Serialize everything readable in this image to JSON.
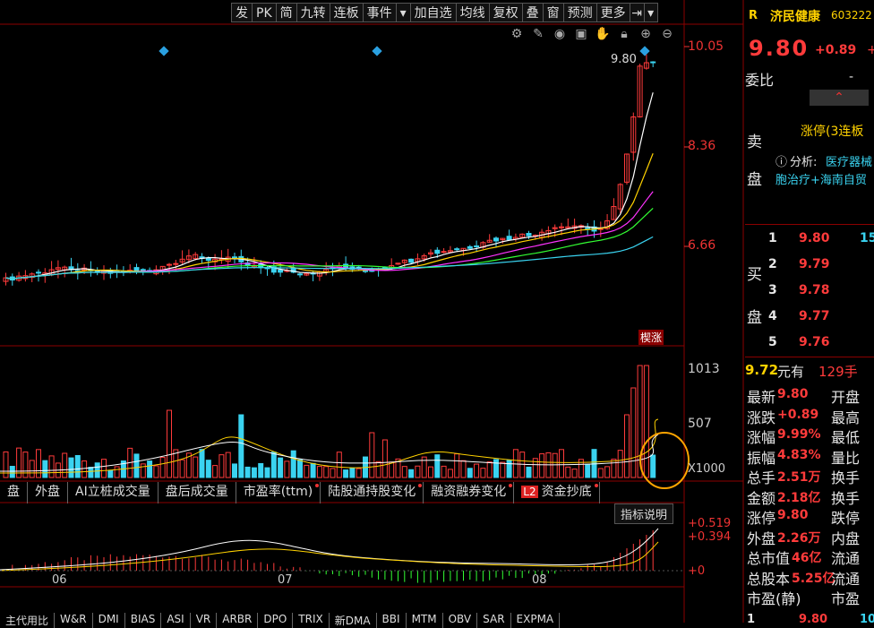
{
  "toolbar": {
    "items": [
      "发",
      "PK",
      "简",
      "九转",
      "连板",
      "事件",
      "加自选",
      "均线",
      "复权",
      "叠",
      "窗",
      "预测",
      "更多"
    ]
  },
  "chart": {
    "price_labels": [
      "10.05",
      "8.36",
      "6.66"
    ],
    "last_price_marker": "9.80",
    "limit_up_tag": "楔涨",
    "volume_labels": [
      "1013",
      "507",
      "X1000"
    ],
    "indicator_labels": [
      "+0.519",
      "+0.394",
      "+0"
    ],
    "indicator_help": "指标说明",
    "month_labels": [
      "06",
      "07",
      "08"
    ]
  },
  "indicator_tabs": [
    "盘",
    "外盘",
    "AI立桩成交量",
    "盘后成交量",
    "市盈率(ttm)",
    "陆股通持股变化",
    "融资融券变化",
    "资金抄底"
  ],
  "l2_badge": "L2",
  "bottom_tabs": [
    "主代用比",
    "W&R",
    "DMI",
    "BIAS",
    "ASI",
    "VR",
    "ARBR",
    "DPO",
    "TRIX",
    "新DMA",
    "BBI",
    "MTM",
    "OBV",
    "SAR",
    "EXPMA"
  ],
  "stock": {
    "tag": "R",
    "name": "济民健康",
    "code": "603222",
    "price": "9.80",
    "change": "+0.89",
    "change_tail": "+",
    "weibi_label": "委比",
    "weibi_value": "-",
    "sell_label_1": "卖",
    "sell_label_2": "盘",
    "limit_status": "涨停(3连板",
    "analysis_label": "分析:",
    "analysis_value": "医疗器械",
    "analysis_line2": "胞治疗+海南自贸",
    "buy_label_1": "买",
    "buy_label_2": "盘",
    "bids": [
      {
        "level": "1",
        "price": "9.80",
        "vol": "15"
      },
      {
        "level": "2",
        "price": "9.79",
        "vol": ""
      },
      {
        "level": "3",
        "price": "9.78",
        "vol": ""
      },
      {
        "level": "4",
        "price": "9.77",
        "vol": ""
      },
      {
        "level": "5",
        "price": "9.76",
        "vol": ""
      }
    ],
    "avg_line_price": "9.72",
    "avg_line_text": "元有",
    "avg_line_qty": "129手"
  },
  "quote": {
    "rows": [
      {
        "l": "最新",
        "v": "9.80",
        "r": "开盘"
      },
      {
        "l": "涨跌",
        "v": "+0.89",
        "r": "最高"
      },
      {
        "l": "涨幅",
        "v": "9.99%",
        "r": "最低"
      },
      {
        "l": "振幅",
        "v": "4.83%",
        "r": "量比"
      },
      {
        "l": "总手",
        "v": "2.51万",
        "r": "换手"
      },
      {
        "l": "金额",
        "v": "2.18亿",
        "r": "换手"
      },
      {
        "l": "涨停",
        "v": "9.80",
        "r": "跌停"
      },
      {
        "l": "外盘",
        "v": "2.26万",
        "r": "内盘"
      },
      {
        "l": "总市值",
        "v": "46亿",
        "r": "流通"
      },
      {
        "l": "总股本",
        "v": "5.25亿",
        "r": "流通"
      },
      {
        "l": "市盈(静)",
        "v": "",
        "r": "市盈"
      }
    ],
    "bottom_row": {
      "l": "1",
      "v": "9.80",
      "r": "10"
    }
  },
  "colors": {
    "up": "#ff3b3b",
    "down": "#3ad3f0",
    "accent": "#ffd200",
    "divider": "#8b0000"
  },
  "chart_data": {
    "type": "candlestick",
    "price_axis": [
      6.66,
      8.36,
      10.05
    ],
    "last_close": 9.8
  }
}
